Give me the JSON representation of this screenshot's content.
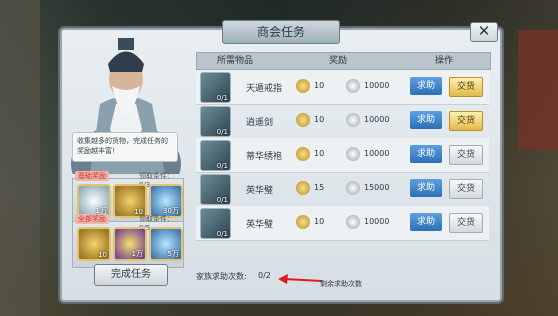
{
  "window": {
    "title": "商会任务",
    "close_glyph": "✕"
  },
  "npc": {
    "speech": "收集越多的货物，完成任务的奖励越丰富！"
  },
  "rewards": {
    "basic": {
      "label": "基础奖励",
      "condition": "领取条件：0/3",
      "items": [
        {
          "icon": "silver-ring-icon",
          "count": "1万"
        },
        {
          "icon": "gold-coin-icon",
          "count": "10"
        },
        {
          "icon": "exp-orb-icon",
          "count": "30万"
        }
      ]
    },
    "full": {
      "label": "全部奖励",
      "condition": "领取条件：0/5",
      "items": [
        {
          "icon": "gold-coin-icon",
          "count": "10"
        },
        {
          "icon": "purple-ring-icon",
          "count": "1万"
        },
        {
          "icon": "exp-orb-icon",
          "count": "5万"
        }
      ]
    }
  },
  "complete_button": "完成任务",
  "table": {
    "headers": {
      "item": "所需物品",
      "reward": "奖励",
      "action": "操作"
    },
    "rows": [
      {
        "icon": "ring-icon",
        "count": "0/1",
        "name": "天遁戒指",
        "coin": "10",
        "silver": "10000",
        "help": "求助",
        "give": "交货",
        "give_style": "gold"
      },
      {
        "icon": "sword-icon",
        "count": "0/1",
        "name": "逍遥剑",
        "coin": "10",
        "silver": "10000",
        "help": "求助",
        "give": "交货",
        "give_style": "gold"
      },
      {
        "icon": "robe-icon",
        "count": "0/1",
        "name": "蒂华绣袍",
        "coin": "10",
        "silver": "10000",
        "help": "求助",
        "give": "交货",
        "give_style": "grey"
      },
      {
        "icon": "jade-disc-icon",
        "count": "0/1",
        "name": "英华璧",
        "coin": "15",
        "silver": "15000",
        "help": "求助",
        "give": "交货",
        "give_style": "grey"
      },
      {
        "icon": "jade-disc-icon",
        "count": "0/1",
        "name": "英华璧",
        "coin": "10",
        "silver": "10000",
        "help": "求助",
        "give": "交货",
        "give_style": "grey"
      }
    ]
  },
  "footer": {
    "label": "家族求助次数:",
    "value": "0/2",
    "annotation": "剩余求助次数"
  },
  "colors": {
    "help_blue": "#3b82c8",
    "give_gold": "#f0cc66",
    "arrow_red": "#d91c1c"
  }
}
